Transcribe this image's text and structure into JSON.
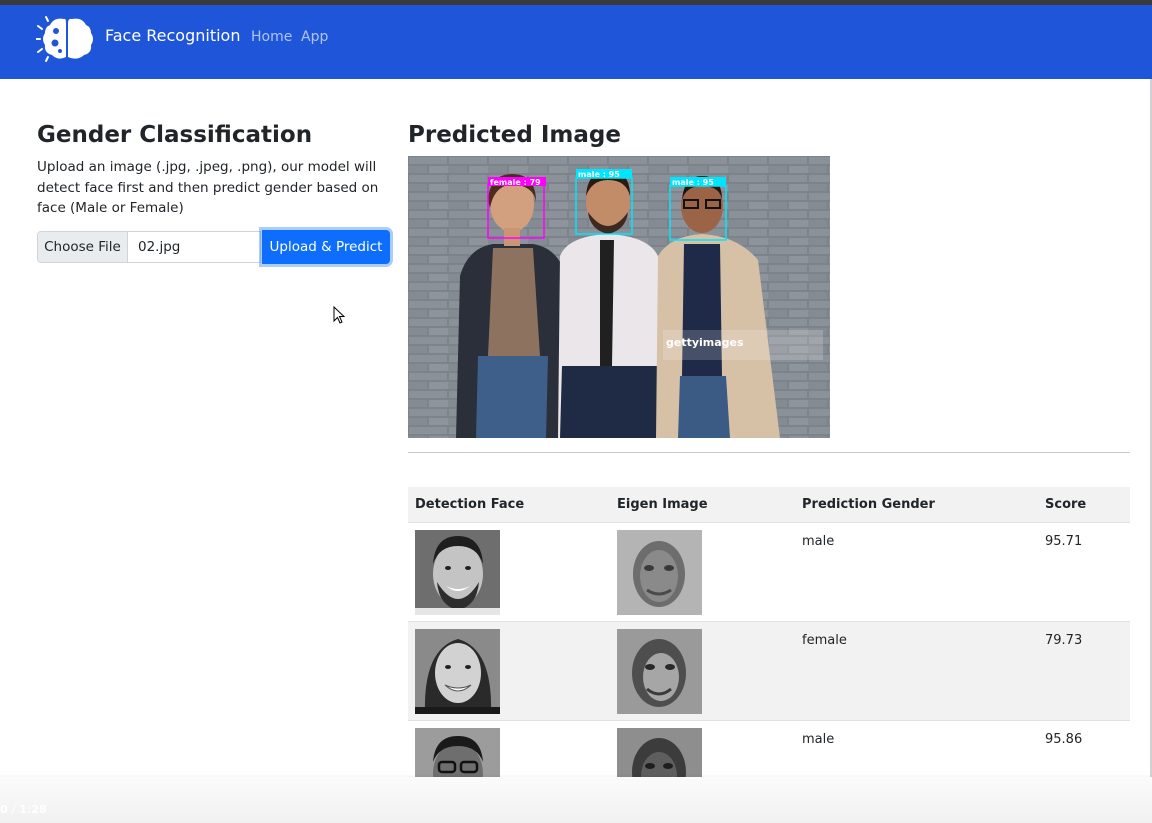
{
  "navbar": {
    "brand_title": "Face Recognition",
    "links": [
      "Home",
      "App"
    ],
    "color": "#1f55d8"
  },
  "gender_classification": {
    "title": "Gender Classification",
    "description": "Upload an image (.jpg, .jpeg, .png), our model will detect face first and then predict gender based on face (Male or Female)",
    "choose_file_label": "Choose File",
    "file_name": "02.jpg",
    "upload_button_label": "Upload & Predict"
  },
  "predicted_image": {
    "title": "Predicted Image",
    "detections": [
      {
        "label": "female : 79",
        "color": "#ff00ff"
      },
      {
        "label": "male : 95",
        "color": "#00e5ff"
      },
      {
        "label": "male : 95",
        "color": "#00e5ff"
      }
    ],
    "watermark": "gettyimages"
  },
  "results_table": {
    "headers": [
      "Detection Face",
      "Eigen Image",
      "Prediction Gender",
      "Score"
    ],
    "rows": [
      {
        "gender": "male",
        "score": "95.71"
      },
      {
        "gender": "female",
        "score": "79.73"
      },
      {
        "gender": "male",
        "score": "95.86"
      }
    ]
  },
  "video": {
    "time": "0 / 1:28"
  },
  "icons": {
    "brand": "brain-icon",
    "cursor": "mouse-pointer-icon"
  }
}
